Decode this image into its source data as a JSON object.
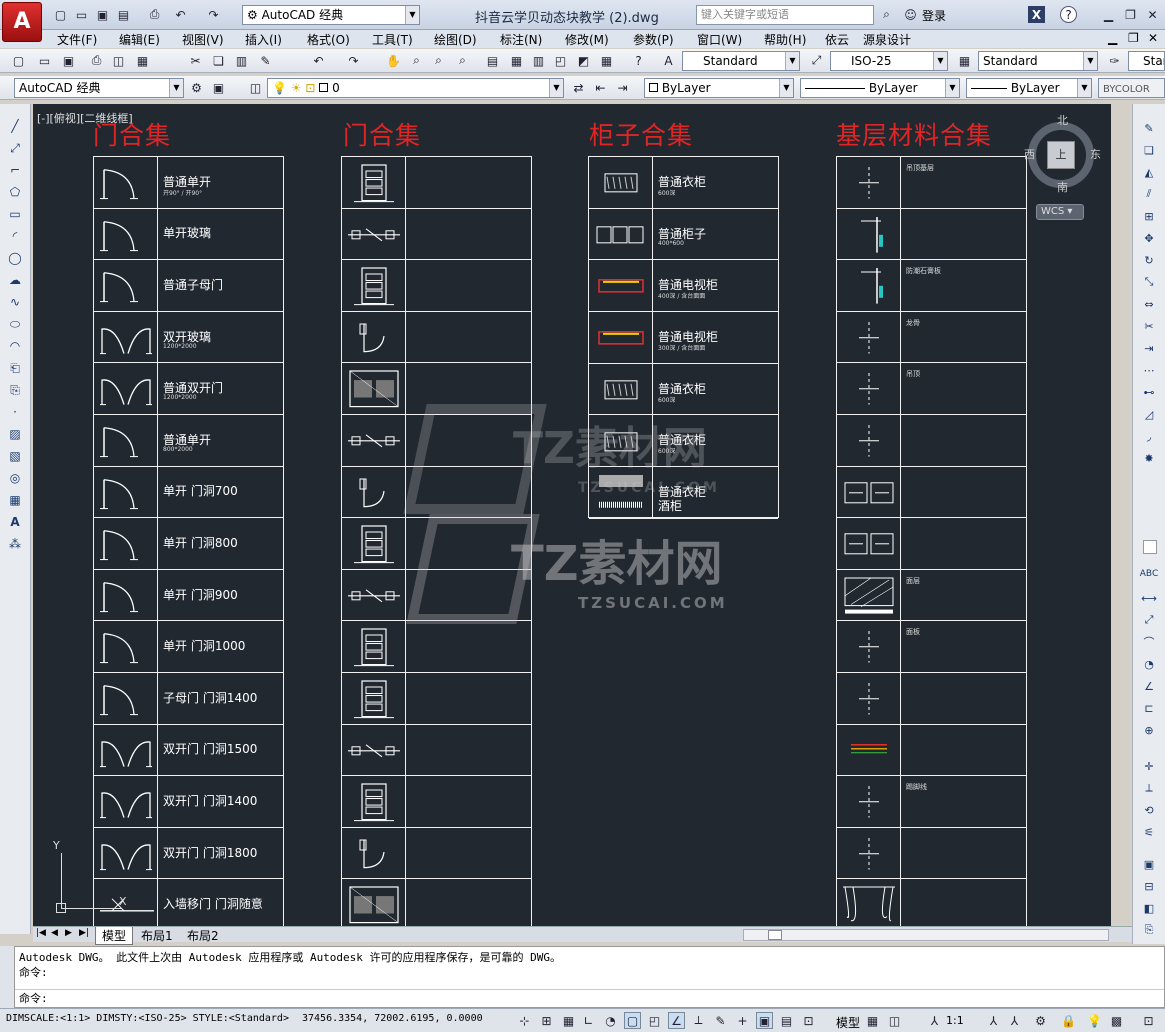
{
  "app": {
    "title": "抖音云学贝动态块教学 (2).dwg",
    "workspace": "AutoCAD 经典",
    "search_placeholder": "键入关键字或短语",
    "login": "登录",
    "help": "?"
  },
  "menu": [
    "文件(F)",
    "编辑(E)",
    "视图(V)",
    "插入(I)",
    "格式(O)",
    "工具(T)",
    "绘图(D)",
    "标注(N)",
    "修改(M)",
    "参数(P)",
    "窗口(W)",
    "帮助(H)",
    "依云",
    "源泉设计"
  ],
  "styles_toolbar": {
    "text_style": "Standard",
    "dim_style": "ISO-25",
    "table_style": "Standard",
    "ml_style": "Star"
  },
  "layers_toolbar": {
    "workspace": "AutoCAD 经典",
    "layer": "0",
    "color": "ByLayer",
    "linetype": "ByLayer",
    "lineweight": "ByLayer",
    "plotstyle": "BYCOLOR"
  },
  "viewport_label": "[-][俯视][二维线框]",
  "viewcube": {
    "north": "北",
    "south": "南",
    "east": "东",
    "west": "西",
    "center": "上",
    "wcs": "WCS"
  },
  "sections": [
    {
      "title": "门合集",
      "rows": [
        {
          "label": "普通单开",
          "sub": "开90° / 开90°"
        },
        {
          "label": "单开玻璃",
          "sub": ""
        },
        {
          "label": "普通子母门",
          "sub": ""
        },
        {
          "label": "双开玻璃",
          "sub": "1200*2000"
        },
        {
          "label": "普通双开门",
          "sub": "1200*2000"
        },
        {
          "label": "普通单开",
          "sub": "800*2000"
        },
        {
          "label": "单开 门洞700",
          "sub": ""
        },
        {
          "label": "单开 门洞800",
          "sub": ""
        },
        {
          "label": "单开 门洞900",
          "sub": ""
        },
        {
          "label": "单开 门洞1000",
          "sub": ""
        },
        {
          "label": "子母门 门洞1400",
          "sub": ""
        },
        {
          "label": "双开门 门洞1500",
          "sub": ""
        },
        {
          "label": "双开门 门洞1400",
          "sub": ""
        },
        {
          "label": "双开门 门洞1800",
          "sub": ""
        },
        {
          "label": "入墙移门 门洞随意",
          "sub": ""
        }
      ]
    },
    {
      "title": "门合集"
    },
    {
      "title": "柜子合集",
      "rows": [
        {
          "label": "普通衣柜",
          "sub": "600深"
        },
        {
          "label": "普通柜子",
          "sub": "400*600"
        },
        {
          "label": "普通电视柜",
          "sub": "400深 / 含台面面"
        },
        {
          "label": "普通电视柜",
          "sub": "300深 / 含台面面"
        },
        {
          "label": "普通衣柜",
          "sub": "600深"
        },
        {
          "label": "普通衣柜",
          "sub": "600深"
        },
        {
          "label": "普通衣柜",
          "sub": ""
        }
      ],
      "extra_label": "酒柜"
    },
    {
      "title": "基层材料合集",
      "notes": [
        "吊顶基层",
        "",
        "防潮石膏板",
        "龙骨",
        "吊顶",
        "",
        "",
        "",
        "面层",
        "面板",
        "",
        "",
        "踢脚线",
        "",
        ""
      ]
    }
  ],
  "watermark": {
    "brand": "TZ素材网",
    "url": "TZSUCAI.COM"
  },
  "layout_tabs": [
    "模型",
    "布局1",
    "布局2"
  ],
  "command": {
    "history_1": "Autodesk DWG。  此文件上次由 Autodesk 应用程序或 Autodesk 许可的应用程序保存，是可靠的 DWG。",
    "history_2": "命令:",
    "prompt": "命令:"
  },
  "status": {
    "left": "DIMSCALE:<1:1> DIMSTY:<ISO-25> STYLE:<Standard>",
    "coords": "37456.3354, 72002.6195, 0.0000",
    "model": "模型",
    "scale": "1:1"
  },
  "colors": {
    "canvas": "#212830",
    "section_title": "#e02525",
    "grid": "#f0f0f0"
  }
}
